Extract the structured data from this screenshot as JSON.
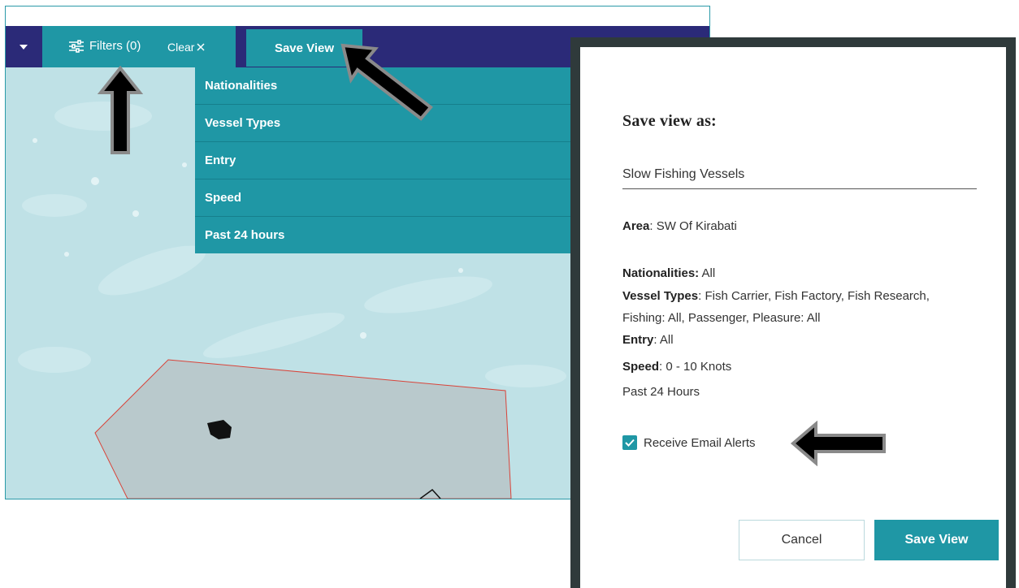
{
  "toolbar": {
    "filters_label": "Filters (0)",
    "clear_label": "Clear",
    "clear_icon": "close-icon",
    "save_view_label": "Save View"
  },
  "dropdown": {
    "items": [
      "Nationalities",
      "Vessel Types",
      "Entry",
      "Speed",
      "Past 24 hours"
    ]
  },
  "dialog": {
    "title": "Save view as:",
    "name_value": "Slow Fishing Vessels",
    "area_label": "Area",
    "area_value": ": SW Of Kirabati",
    "nationalities_label": "Nationalities:",
    "nationalities_value": " All",
    "vessel_types_label": "Vessel Types",
    "vessel_types_value_1": ": Fish Carrier, Fish Factory, Fish Research,",
    "vessel_types_value_2": "Fishing: All, Passenger, Pleasure: All",
    "entry_label": "Entry",
    "entry_value": ": All",
    "speed_label": "Speed",
    "speed_value": ": 0 - 10 Knots",
    "past_label": "Past 24 Hours",
    "email_alerts_label": "Receive Email Alerts",
    "email_alerts_checked": true,
    "cancel_label": "Cancel",
    "save_label": "Save View"
  },
  "colors": {
    "toolbar": "#2b2a78",
    "accent": "#1f97a5",
    "dialog_border": "#2f3a3b",
    "map_water": "#bfe1e6",
    "area_outline": "#d9443a"
  }
}
